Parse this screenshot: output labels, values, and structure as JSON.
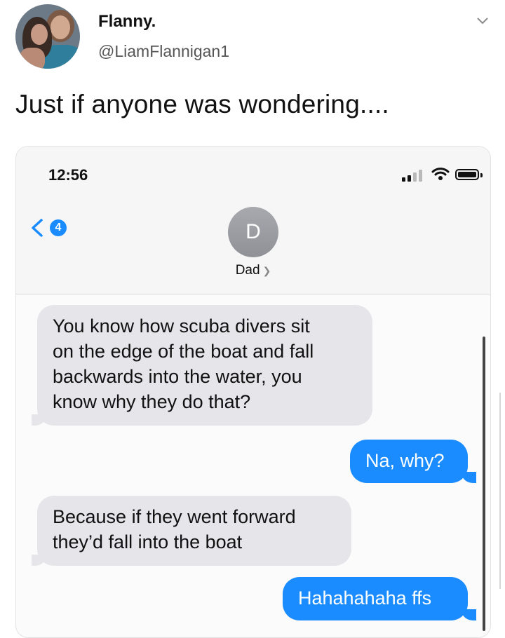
{
  "tweet": {
    "name": "Flanny.",
    "handle": "@LiamFlannigan1",
    "text": "Just if anyone was wondering...."
  },
  "phone": {
    "status": {
      "time": "12:56"
    },
    "header": {
      "back_badge": "4",
      "contact_initial": "D",
      "contact_name": "Dad"
    },
    "messages": [
      {
        "direction": "incoming",
        "lines": [
          "You know how scuba divers sit",
          "on the edge of the boat and fall",
          "backwards into the water, you",
          "know why they do that?"
        ]
      },
      {
        "direction": "outgoing",
        "lines": [
          "Na, why?"
        ]
      },
      {
        "direction": "incoming",
        "lines": [
          "Because if they went forward",
          "they’d fall into the boat"
        ]
      },
      {
        "direction": "outgoing",
        "lines": [
          "Hahahahaha ffs"
        ]
      }
    ]
  },
  "colors": {
    "imessage_blue": "#1a8cff",
    "incoming_gray": "#e5e5ea"
  },
  "icons": [
    "chevron-down-icon",
    "signal-icon",
    "wifi-icon",
    "battery-icon",
    "back-chevron-icon"
  ]
}
